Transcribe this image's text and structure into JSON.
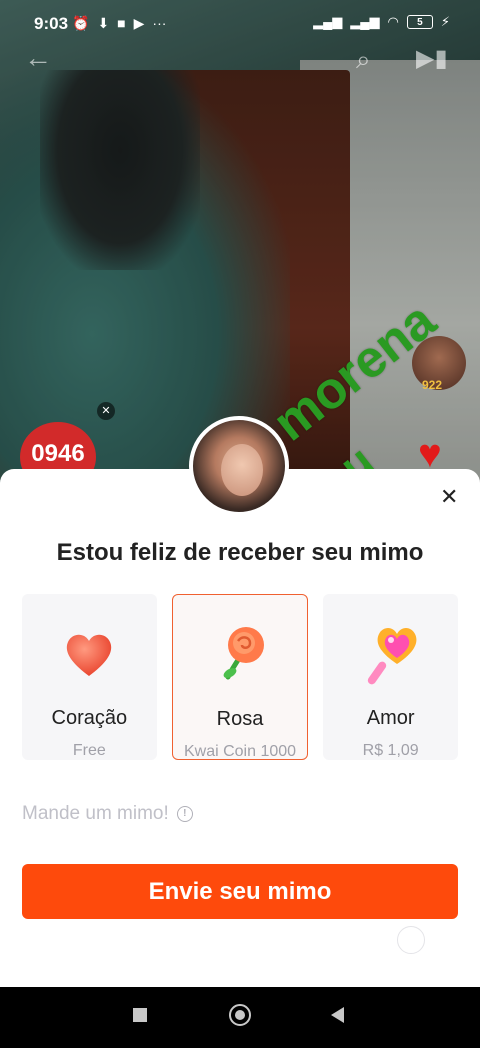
{
  "status_bar": {
    "time": "9:03",
    "battery": "5"
  },
  "video": {
    "overlay_word_1": "morena",
    "overlay_word_2": "eu",
    "timer_badge": "0946",
    "viewer_count": "922"
  },
  "sheet": {
    "title": "Estou feliz de receber seu mimo",
    "gifts": [
      {
        "name": "Coração",
        "price": "Free",
        "icon": "heart-gift-icon"
      },
      {
        "name": "Rosa",
        "price": "Kwai Coin 1000",
        "icon": "rose-gift-icon",
        "selected": true
      },
      {
        "name": "Amor",
        "price": "R$ 1,09",
        "icon": "heart-wand-gift-icon"
      }
    ],
    "hint": "Mande um mimo!",
    "send_button": "Envie seu mimo"
  },
  "colors": {
    "accent": "#fe4a0c",
    "selected_border": "#f06030"
  }
}
